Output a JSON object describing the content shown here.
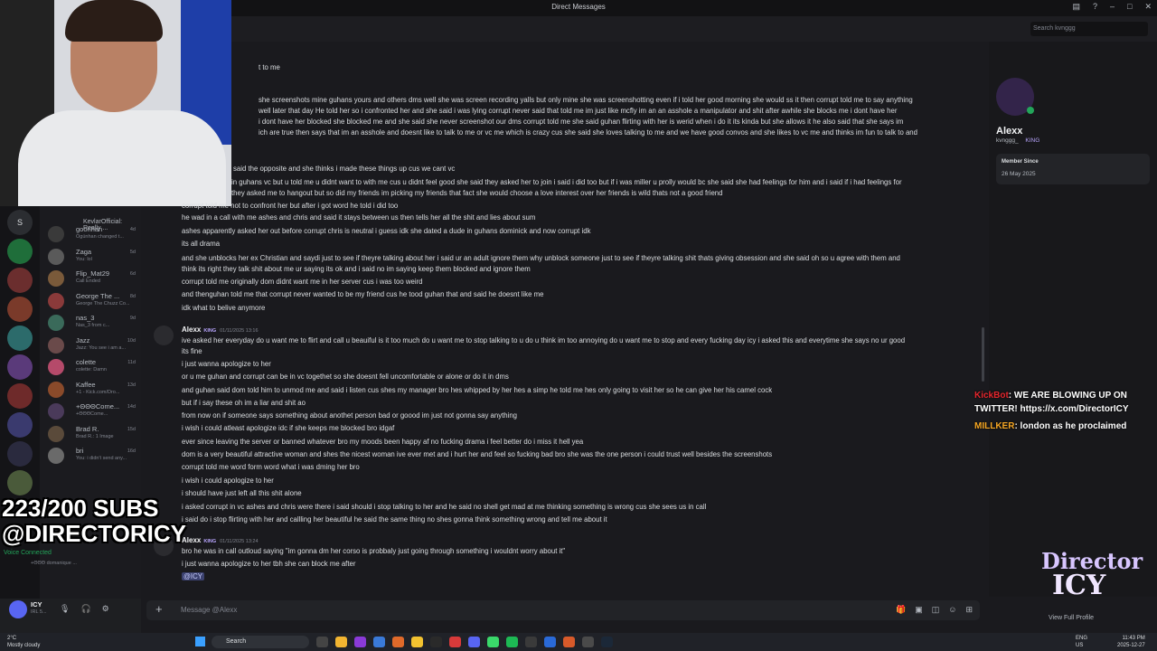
{
  "window": {
    "title": "Direct Messages"
  },
  "search": {
    "placeholder": "Search kvnggg"
  },
  "dm_list": [
    {
      "name": "goonhan",
      "sub": "Ogúnhan changed t...",
      "ts": "4d"
    },
    {
      "name": "Zaga",
      "sub": "You: lol",
      "ts": "5d"
    },
    {
      "name": "Flip_Mat29",
      "sub": "Call Ended",
      "ts": "6d"
    },
    {
      "name": "George The ...",
      "sub": "George The Chuzz Co...",
      "ts": "8d"
    },
    {
      "name": "nas_3",
      "sub": "Nas_3 from c...",
      "ts": "9d"
    },
    {
      "name": "Jazz",
      "sub": "Jazz: You see i am a...",
      "ts": "10d"
    },
    {
      "name": "colette",
      "sub": "colette: Damn",
      "ts": "11d"
    },
    {
      "name": "Kaffee",
      "sub": "+1 - Kick.com/Dro...",
      "ts": "13d"
    },
    {
      "name": "+ΘΘΘCome...",
      "sub": "+ΘΘΘCome...",
      "ts": "14d"
    },
    {
      "name": "Brad R.",
      "sub": "Brad R.: 1 Image",
      "ts": "15d"
    },
    {
      "name": "bri",
      "sub": "You: i didn't send any...",
      "ts": "16d"
    }
  ],
  "dm_top_partial": "KevlarOfficial: Really ...",
  "voice": {
    "status": "Voice Connected",
    "sub": "+ΘΘΘ domanique ..."
  },
  "user": {
    "name": "ICY",
    "status": "IRL 5..."
  },
  "messages_pre": [
    "t to me",
    "she screenshots mine guhans yours and others dms well she was screen recording yalls but only mine she was screenshotting even if i told her good morning she would ss it then corrupt told me to say anything",
    "well later that day He told her so i confronted her and she said i was lying corrupt never said that told me im just like mcfly im an an asshole a manipulator and shit after awhile she blocks me i dont have her",
    "i dont have her blocked she blocked me and she said she never screenshot our dms corrupt told me she said guhan flirting with her is werid when i do it its kinda but she allows it he also said that she says im",
    "ich are true then says that im an asshole and doesnt like to talk to me or vc me which is crazy cus she said she loves talking to me and we have good convos and she likes to vc me and thinks im fun to talk to and",
    "said the opposite and she thinks i made these things up cus we cant vc",
    "in guhans vc but u told me u didnt want to with me cus u didnt feel good she said they asked her to join i said i did too but if i was miller u prolly would bc she said she had feelings for him and i said if i had feelings for",
    "they asked me to hangout but so did my friends im picking my friends that fact she would choose a love interest over her friends is wild thats not a good friend",
    "corrupt told me not to confront her but after i got word he told i did too",
    "he wad in a call with me ashes and chris and said it stays between us then tells her all the shit and lies about sum",
    "ashes apparently asked her out before corrupt chris is neutral i guess idk she dated a dude in guhans dominick and now corrupt idk",
    "its all drama",
    "and she unblocks her ex Christian and saydi just to see if theyre talking about her i said ur an adult ignore them why unblock someone just to see if theyre talking shit thats giving obsession and she said oh so u agree with them and",
    "think its right they talk shit about me ur saying its ok and i said no im saying keep them blocked and ignore them",
    "corrupt told me originally dom didnt want me in her server cus i was too weird",
    "and thenguhan told me that corrupt never wanted to be my friend cus he tood guhan that and said he doesnt like me",
    "idk what to belive anymore"
  ],
  "message_group_1": {
    "author": "Alexx",
    "badge": "KING",
    "timestamp": "01/11/2025 13:16",
    "lines": [
      "ive asked her everyday do u want me to flirt and call u beauiful is it too much do u want me to stop talking to u do u think im too annoying do u want me to stop and every fucking day icy i asked this and everytime she says no ur good",
      "its fine",
      "i just wanna apologize to her",
      "or u me guhan and corrupt can be in vc togethet so she doesnt fell uncomfortable or alone or do it in dms",
      "and guhan said dom told him to unmod me and said i listen cus shes my manager bro hes whipped by her hes a simp he told me hes only going to visit her so he can give her his camel cock",
      "but if i say these oh im a liar and shit ao",
      "from now on if someone says something about anothet person bad or goood im just not gonna say anything",
      "i wish i could atleast apologize idc if she keeps me blocked bro idgaf",
      "ever since leaving the server or banned whatever bro my moods been happy af no fucking drama i feel better do i miss it hell yea",
      "dom is a very beautiful attractive woman and shes the nicest woman ive ever met and i hurt her and feel so fucking bad bro she was the one person i could trust well besides the screenshots",
      "corrupt told me word form word what i was dming her bro",
      "i wish i could apologize to her",
      "i should have just left all this shit alone",
      "i asked corrupt in vc ashes and chris were there i said should i stop talking to her and he said no shell get mad at me thinking something is wrong cus she sees us in call",
      "i said do i stop flirting with her and callling her beautiful he said the same thing no shes gonna think something wrong and tell me about it"
    ]
  },
  "message_group_2": {
    "author": "Alexx",
    "badge": "KING",
    "timestamp": "01/11/2025 13:24",
    "lines": [
      "bro he was in call outloud saying \"im gonna dm her corso is probbaly just going through something i wouldnt worry about it\"",
      "i just wanna apologize to her tbh she can block me after"
    ],
    "mention": "@ICY"
  },
  "composer": {
    "placeholder": "Message @Alexx"
  },
  "profile": {
    "name": "Alexx",
    "username": "kvnggg_",
    "badge": "KING",
    "member_since_label": "Member Since",
    "member_since": "26 May 2025",
    "view_full": "View Full Profile"
  },
  "overlay_chat": [
    {
      "user": "KickBot",
      "text": ": WE ARE BLOWING UP ON TWITTER! https://x.com/DirectorICY"
    },
    {
      "user": "MILLKER",
      "text": ": london as he proclaimed"
    }
  ],
  "overlay": {
    "subs": "223/200 SUBS",
    "handle": "@DIRECTORICY",
    "logo_line1": "Director",
    "logo_line2": "ICY"
  },
  "taskbar": {
    "weather_temp": "2°C",
    "weather_text": "Mostly cloudy",
    "search": "Search",
    "lang": "ENG",
    "region": "US",
    "time": "11:43 PM",
    "date": "2025-12-27"
  },
  "colors": {
    "accent": "#5865f2",
    "online": "#23a55a",
    "kickbot": "#e5262d",
    "millker": "#f5a623"
  }
}
